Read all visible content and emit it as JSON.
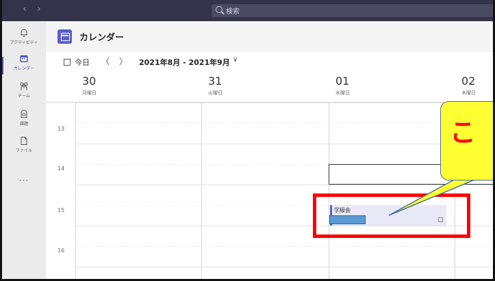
{
  "titlebar": {
    "back": "‹",
    "forward": "›",
    "search_placeholder": "検索"
  },
  "rail": {
    "items": [
      {
        "label": "アクティビティ",
        "icon": "bell-icon"
      },
      {
        "label": "カレンダー",
        "icon": "calendar-icon",
        "active": true
      },
      {
        "label": "チーム",
        "icon": "people-icon"
      },
      {
        "label": "課題",
        "icon": "assignments-icon"
      },
      {
        "label": "ファイル",
        "icon": "file-icon"
      }
    ],
    "more": "···"
  },
  "header": {
    "title": "カレンダー"
  },
  "toolbar": {
    "today": "今日",
    "prev": "〈",
    "next": "〉",
    "range": "2021年8月 - 2021年9月",
    "range_caret": "∨"
  },
  "days": [
    {
      "num": "30",
      "name": "月曜日"
    },
    {
      "num": "31",
      "name": "火曜日"
    },
    {
      "num": "01",
      "name": "水曜日"
    },
    {
      "num": "02",
      "name": "木曜日"
    }
  ],
  "hours": [
    "13",
    "14",
    "15",
    "16"
  ],
  "event": {
    "title": "学級会"
  },
  "annotation": {
    "callout_text": "こ",
    "highlight_color": "#ff0000",
    "callout_color": "#ffff33"
  }
}
